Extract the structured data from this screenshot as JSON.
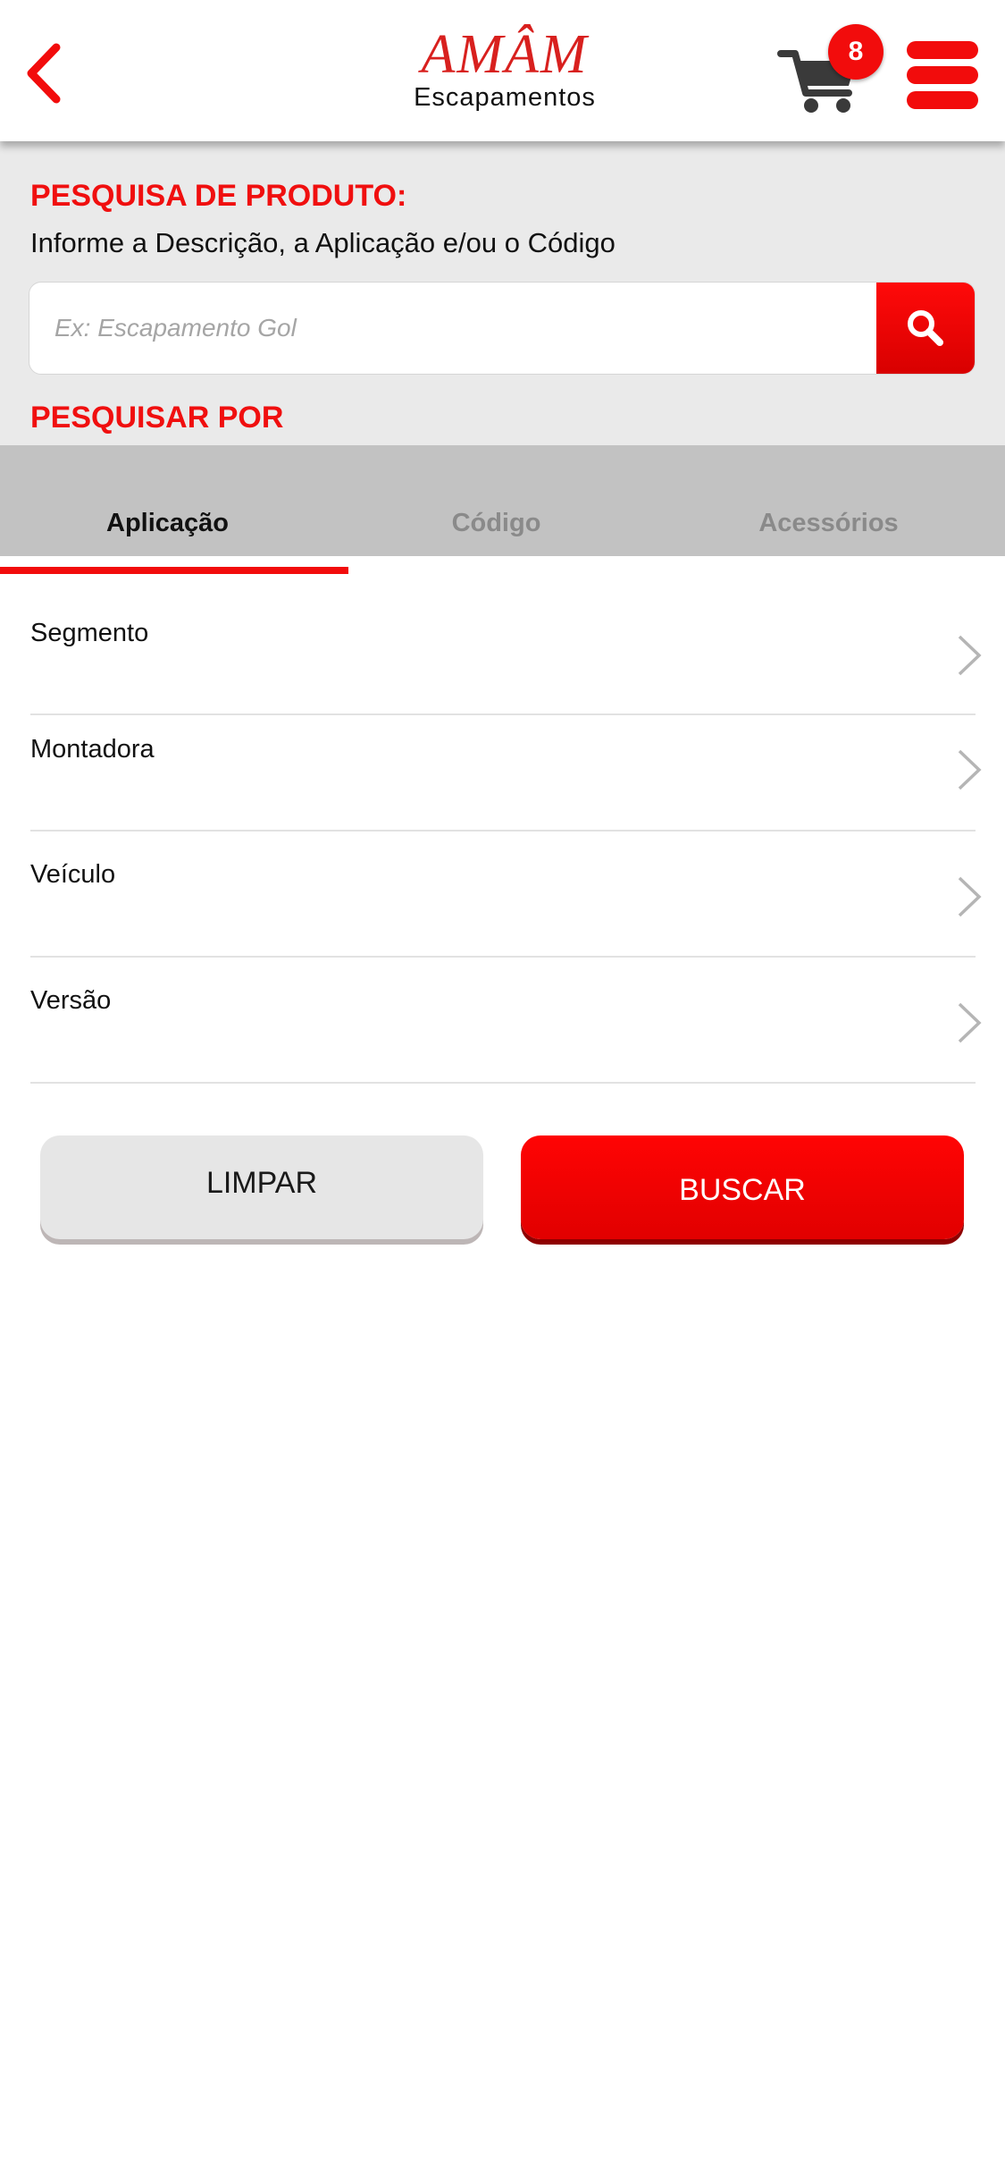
{
  "header": {
    "logo_main": "AMÂM",
    "logo_sub": "Escapamentos",
    "cart_count": "8"
  },
  "search": {
    "title": "PESQUISA DE PRODUTO:",
    "hint": "Informe a Descrição, a Aplicação e/ou o Código",
    "placeholder": "Ex: Escapamento Gol",
    "value": "",
    "search_by_label": "PESQUISAR POR"
  },
  "tabs": [
    {
      "label": "Aplicação",
      "active": true
    },
    {
      "label": "Código",
      "active": false
    },
    {
      "label": "Acessórios",
      "active": false
    }
  ],
  "filters": [
    {
      "label": "Segmento"
    },
    {
      "label": "Montadora"
    },
    {
      "label": "Veículo"
    },
    {
      "label": "Versão"
    }
  ],
  "actions": {
    "clear_label": "LIMPAR",
    "search_label": "BUSCAR"
  },
  "colors": {
    "accent": "#f20c0c",
    "header_bg": "#ffffff",
    "section_bg": "#eaeaea",
    "tabs_bg": "#c2c2c2",
    "cart_icon": "#3a3a3a"
  },
  "icons": {
    "back": "chevron-left-icon",
    "cart": "shopping-cart-icon",
    "menu": "hamburger-menu-icon",
    "search": "search-icon",
    "row_chevron": "chevron-right-icon"
  }
}
